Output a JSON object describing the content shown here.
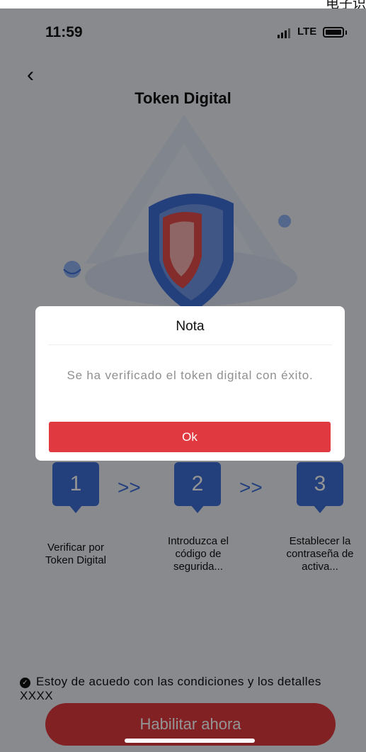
{
  "top_text": "电子识",
  "status_bar": {
    "time": "11:59",
    "network": "LTE"
  },
  "header": {
    "title": "Token Digital"
  },
  "steps": [
    {
      "number": "1",
      "label": "Verificar por Token Digital"
    },
    {
      "number": "2",
      "label": "Introduzca el código de segurida..."
    },
    {
      "number": "3",
      "label": "Establecer la contraseña de activa..."
    }
  ],
  "step_separator": ">>",
  "agreement": {
    "text": "Estoy de acuedo con las condiciones y los detalles XXXX"
  },
  "enable_button": {
    "label": "Habilitar ahora"
  },
  "dialog": {
    "title": "Nota",
    "message": "Se ha verificado el token digital con éxito.",
    "ok_label": "Ok"
  },
  "colors": {
    "accent": "#e0393f",
    "primary_blue": "#3d6fd6",
    "background": "#ebeef5"
  }
}
